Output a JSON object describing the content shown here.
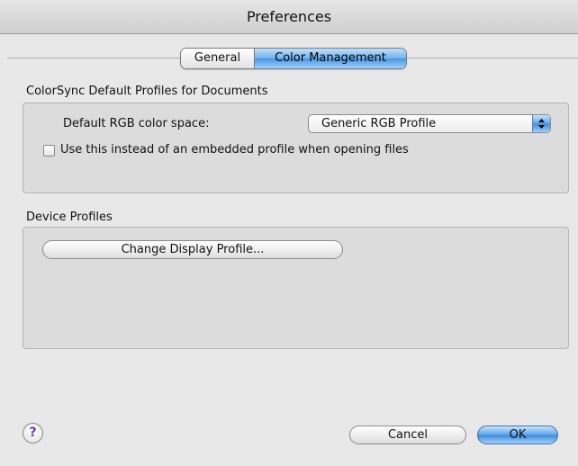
{
  "window": {
    "title": "Preferences"
  },
  "tabs": [
    {
      "label": "General",
      "selected": false
    },
    {
      "label": "Color Management",
      "selected": true
    }
  ],
  "colorsync": {
    "section_title": "ColorSync Default Profiles for Documents",
    "rgb_label": "Default RGB color space:",
    "rgb_value": "Generic RGB Profile",
    "checkbox_label": "Use this instead of an embedded profile when opening files",
    "checkbox_checked": false
  },
  "device": {
    "section_title": "Device Profiles",
    "change_display_button": "Change Display Profile..."
  },
  "footer": {
    "help_symbol": "?",
    "cancel_label": "Cancel",
    "ok_label": "OK"
  },
  "colors": {
    "accent": "#5aa3ec",
    "window_bg": "#e8e8e8",
    "group_bg": "#dcdcdc"
  }
}
